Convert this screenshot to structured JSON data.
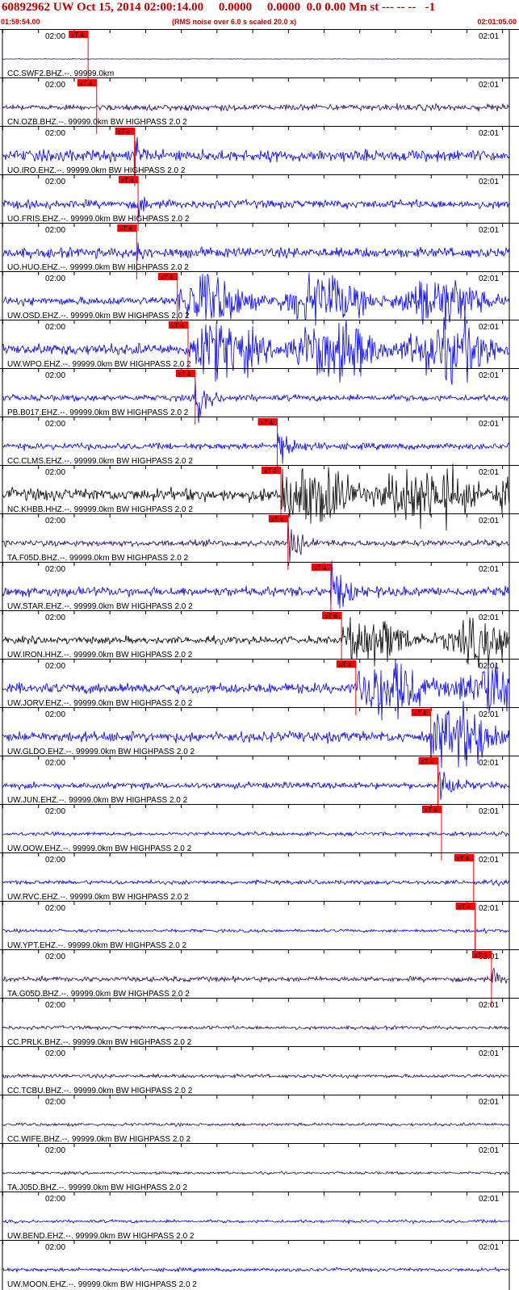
{
  "header": {
    "title": "60892962 UW Oct 15, 2014 02:00:14.00     0.0000     0.0000  0.0 0.00 Mn st --- -- --   -1",
    "start_time": "01:59:54.00",
    "rms_note": "(RMS noise over 6.0 s scaled 20.0 x)",
    "end_time": "02:01:05.00"
  },
  "chart_data": {
    "type": "line",
    "plot_kind": "seismogram record section",
    "x_unit": "seconds after 01:59:54.00",
    "xlim": [
      0,
      71
    ],
    "tick_labels": [
      "02:00",
      "02:01"
    ],
    "minor_tick_interval_s": 5,
    "pick_label": "xT 4",
    "colors": {
      "blue": "#0000ee",
      "black": "#000000",
      "navy": "#2a0a60",
      "pick": "#ff0000",
      "axis": "#000000"
    },
    "traces": [
      {
        "label": "CC.SWF2.BHZ.--. 99999.0km",
        "pick_s": 12.0,
        "color": "navy",
        "shape": "flat",
        "energy": 0.05
      },
      {
        "label": "CN.OZB.BHZ.--. 99999.0km BW  HIGHPASS  2.0  2",
        "pick_s": 13.2,
        "color": "navy",
        "shape": "noise",
        "energy": 0.9
      },
      {
        "label": "UO.IRO.EHZ.--. 99999.0km BW  HIGHPASS  2.0  2",
        "pick_s": 18.5,
        "color": "blue",
        "shape": "spike",
        "energy": 2.2
      },
      {
        "label": "UO.FRIS.EHZ.--. 99999.0km BW  HIGHPASS  2.0  2",
        "pick_s": 19.0,
        "color": "blue",
        "shape": "spike",
        "energy": 1.6
      },
      {
        "label": "UO.HUO.EHZ.--. 99999.0km BW  HIGHPASS  2.0  2",
        "pick_s": 18.8,
        "color": "blue",
        "shape": "spike",
        "energy": 1.9
      },
      {
        "label": "UW.OSD.EHZ.--. 99999.0km BW  HIGHPASS  2.0  2",
        "pick_s": 24.5,
        "color": "blue",
        "shape": "burst",
        "energy": 1.6
      },
      {
        "label": "UW.WPO.EHZ.--. 99999.0km BW  HIGHPASS  2.0  2",
        "pick_s": 26.0,
        "color": "blue",
        "shape": "burst",
        "energy": 2.2
      },
      {
        "label": "PB.B017.EHZ.--. 99999.0km BW  HIGHPASS  2.0  2",
        "pick_s": 27.0,
        "color": "blue",
        "shape": "quake",
        "energy": 1.2
      },
      {
        "label": "CC.CLMS.EHZ.--. 99999.0km BW  HIGHPASS  2.0  2",
        "pick_s": 38.5,
        "color": "blue",
        "shape": "quake",
        "energy": 1.2
      },
      {
        "label": "NC.KHBB.HHZ.--. 99999.0km BW  HIGHPASS  2.0  2",
        "pick_s": 39.0,
        "color": "black",
        "shape": "burst",
        "energy": 2.4
      },
      {
        "label": "TA.F05D.BHZ.--. 99999.0km BW  HIGHPASS  2.0  2",
        "pick_s": 40.0,
        "color": "navy",
        "shape": "quake",
        "energy": 1.2
      },
      {
        "label": "UW.STAR.EHZ.--. 99999.0km BW  HIGHPASS  2.0  2",
        "pick_s": 46.0,
        "color": "blue",
        "shape": "quake",
        "energy": 1.8
      },
      {
        "label": "UW.IRON.HHZ.--. 99999.0km BW  HIGHPASS  2.0  2",
        "pick_s": 47.5,
        "color": "black",
        "shape": "burst",
        "energy": 1.4
      },
      {
        "label": "UW.JORV.EHZ.--. 99999.0km BW  HIGHPASS  2.0  2",
        "pick_s": 49.5,
        "color": "blue",
        "shape": "burst",
        "energy": 2.0
      },
      {
        "label": "UW.GLDO.EHZ.--. 99999.0km BW  HIGHPASS  2.0  2",
        "pick_s": 60.0,
        "color": "blue",
        "shape": "burst",
        "energy": 2.0
      },
      {
        "label": "UW.JUN.EHZ.--. 99999.0km BW  HIGHPASS  2.0  2",
        "pick_s": 61.0,
        "color": "blue",
        "shape": "quake",
        "energy": 1.2
      },
      {
        "label": "UW.OOW.EHZ.--. 99999.0km BW  HIGHPASS  2.0  2",
        "pick_s": 61.5,
        "color": "blue",
        "shape": "noise",
        "energy": 0.7
      },
      {
        "label": "UW.RVC.EHZ.--. 99999.0km BW  HIGHPASS  2.0  2",
        "pick_s": 66.0,
        "color": "blue",
        "shape": "noise",
        "energy": 0.8
      },
      {
        "label": "UW.YPT.EHZ.--. 99999.0km BW  HIGHPASS  2.0  2",
        "pick_s": 66.2,
        "color": "blue",
        "shape": "noise",
        "energy": 0.6
      },
      {
        "label": "TA.G05D.BHZ.--. 99999.0km BW  HIGHPASS  2.0  2",
        "pick_s": 68.5,
        "color": "navy",
        "shape": "late",
        "energy": 1.0
      },
      {
        "label": "CC.PRLK.BHZ.--. 99999.0km BW  HIGHPASS  2.0  2",
        "pick_s": null,
        "color": "navy",
        "shape": "noise",
        "energy": 0.7
      },
      {
        "label": "CC.TCBU.BHZ.--. 99999.0km BW  HIGHPASS  2.0  2",
        "pick_s": null,
        "color": "navy",
        "shape": "noise",
        "energy": 0.7
      },
      {
        "label": "CC.WIFE.BHZ.--. 99999.0km BW  HIGHPASS  2.0  2",
        "pick_s": null,
        "color": "navy",
        "shape": "noise",
        "energy": 0.6
      },
      {
        "label": "TA.J05D.BHZ.--. 99999.0km BW  HIGHPASS  2.0  2",
        "pick_s": null,
        "color": "navy",
        "shape": "noise",
        "energy": 0.5
      },
      {
        "label": "UW.BEND.EHZ.--. 99999.0km BW  HIGHPASS  2.0  2",
        "pick_s": null,
        "color": "blue",
        "shape": "noise",
        "energy": 0.6
      },
      {
        "label": "UW.MOON.EHZ.--. 99999.0km BW  HIGHPASS  2.0  2",
        "pick_s": null,
        "color": "blue",
        "shape": "noise",
        "energy": 0.7
      }
    ]
  }
}
